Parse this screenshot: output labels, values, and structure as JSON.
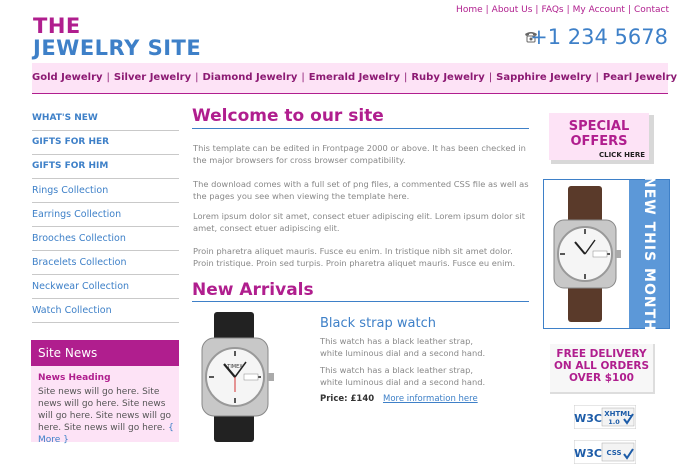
{
  "header": {
    "logo_line1": "THE",
    "logo_line2": "JEWELRY SITE",
    "phone": "+1 234 5678",
    "top_links": [
      "Home",
      "About Us",
      "FAQs",
      "My Account",
      "Contact"
    ]
  },
  "categories": [
    "Gold Jewelry",
    "Silver Jewelry",
    "Diamond Jewelry",
    "Emerald Jewelry",
    "Ruby Jewelry",
    "Sapphire Jewelry",
    "Pearl Jewelry"
  ],
  "sidebar": {
    "items": [
      {
        "label": "WHAT'S NEW",
        "bold": true
      },
      {
        "label": "GIFTS FOR HER",
        "bold": true
      },
      {
        "label": "GIFTS FOR HIM",
        "bold": true
      },
      {
        "label": "Rings Collection",
        "bold": false
      },
      {
        "label": "Earrings Collection",
        "bold": false
      },
      {
        "label": "Brooches Collection",
        "bold": false
      },
      {
        "label": "Bracelets Collection",
        "bold": false
      },
      {
        "label": "Neckwear Collection",
        "bold": false
      },
      {
        "label": "Watch Collection",
        "bold": false
      }
    ],
    "news": {
      "title": "Site News",
      "heading": "News Heading",
      "text": "Site news will go here. Site news will go here. Site news will go here. Site news will go here. Site news will go here.",
      "more_label": "{ More }"
    }
  },
  "main": {
    "welcome_title": "Welcome to our site",
    "paragraphs": [
      "This template can be edited in Frontpage 2000 or above. It has been checked in the major browsers for cross browser compatibility.",
      "The download comes with a full set of png files, a commented CSS file as well as the pages you see when viewing the template here.",
      "Lorem ipsum dolor sit amet, consect etuer adipiscing elit. Lorem ipsum dolor sit amet, consect etuer adipiscing elit.",
      "Proin pharetra aliquet mauris. Fusce eu enim. In tristique nibh sit amet dolor. Proin tristique. Proin sed turpis. Proin pharetra aliquet mauris. Fusce eu enim."
    ],
    "new_arrivals_title": "New Arrivals",
    "product": {
      "title": "Black strap watch",
      "desc1": "This watch has a black leather strap, white luminous dial and a second hand.",
      "desc2": "This watch has a black leather strap, white luminous dial and a second hand.",
      "price": "Price: £140",
      "more_info": "More information here",
      "brand": "TIMEX",
      "day": "WED",
      "date": "28"
    }
  },
  "right": {
    "special_line1": "SPECIAL",
    "special_line2": "OFFERS",
    "special_click": "CLICK HERE",
    "new_this_month": "NEW THIS MONTH",
    "free_delivery": [
      "FREE DELIVERY",
      "ON ALL ORDERS",
      "OVER $100"
    ],
    "badges": [
      {
        "logo": "W3C",
        "label": "XHTML",
        "version": "1.0"
      },
      {
        "logo": "W3C",
        "label": "CSS",
        "version": ""
      }
    ]
  },
  "colors": {
    "magenta": "#b01e8e",
    "blue": "#3e80c8",
    "pink_bg": "#fde3f6"
  }
}
